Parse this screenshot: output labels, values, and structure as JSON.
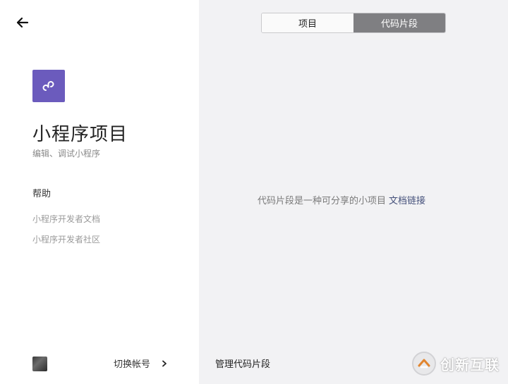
{
  "sidebar": {
    "back_icon": "arrow-left-icon",
    "app_icon": "miniprogram-logo-icon",
    "app_icon_color": "#6b5bbd",
    "title": "小程序项目",
    "subtitle": "编辑、调试小程序",
    "help": {
      "heading": "帮助",
      "links": [
        {
          "label": "小程序开发者文档"
        },
        {
          "label": "小程序开发者社区"
        }
      ]
    },
    "footer": {
      "switch_account_label": "切换帐号",
      "chevron_icon": "chevron-right-icon"
    }
  },
  "main": {
    "tabs": [
      {
        "label": "项目",
        "active": false
      },
      {
        "label": "代码片段",
        "active": true
      }
    ],
    "empty_message": "代码片段是一种可分享的小项目",
    "doc_link_label": "文档链接",
    "manage_label": "管理代码片段"
  },
  "watermark": {
    "text": "创新互联"
  }
}
